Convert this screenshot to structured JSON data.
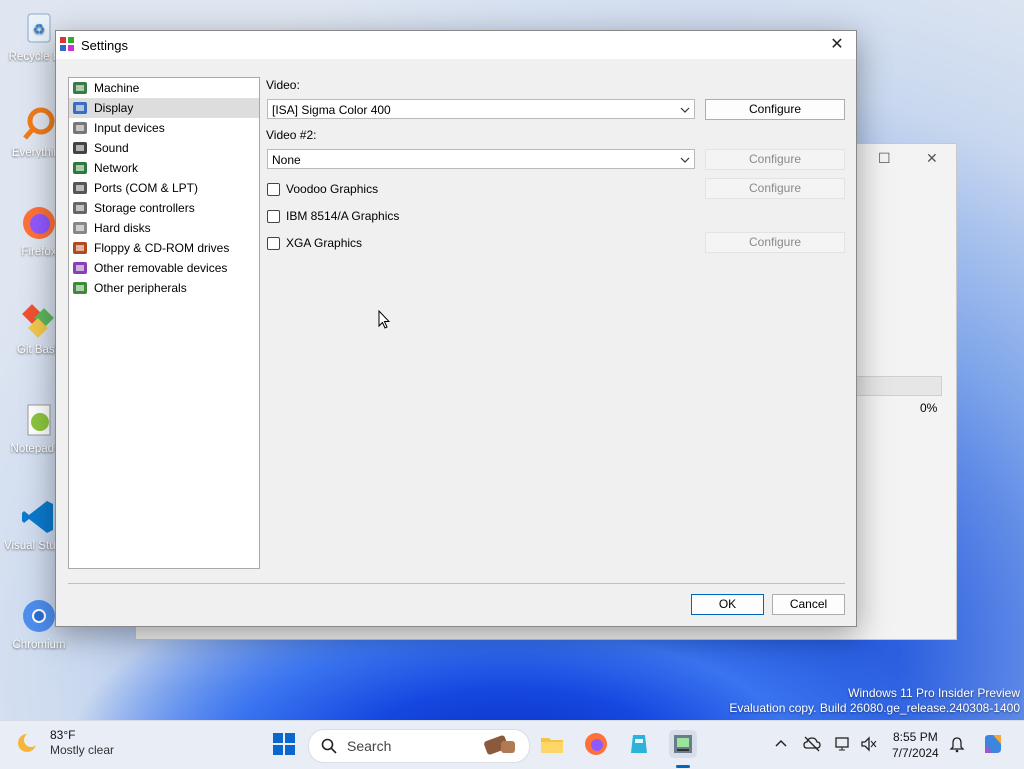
{
  "desktop": {
    "icons": [
      {
        "label": "Recycle Bin"
      },
      {
        "label": "Everything"
      },
      {
        "label": "Firefox"
      },
      {
        "label": "Git Bash"
      },
      {
        "label": "Notepad++"
      },
      {
        "label": "Visual Studio Code"
      },
      {
        "label": "Chromium"
      }
    ]
  },
  "background_window": {
    "progress_percent": 0,
    "progress_text": "0%"
  },
  "dialog": {
    "title": "Settings",
    "tree": [
      {
        "label": "Machine",
        "icon": "machine-icon",
        "selected": false
      },
      {
        "label": "Display",
        "icon": "display-icon",
        "selected": true
      },
      {
        "label": "Input devices",
        "icon": "input-devices-icon",
        "selected": false
      },
      {
        "label": "Sound",
        "icon": "sound-icon",
        "selected": false
      },
      {
        "label": "Network",
        "icon": "network-icon",
        "selected": false
      },
      {
        "label": "Ports (COM & LPT)",
        "icon": "ports-icon",
        "selected": false
      },
      {
        "label": "Storage controllers",
        "icon": "storage-controllers-icon",
        "selected": false
      },
      {
        "label": "Hard disks",
        "icon": "hard-disks-icon",
        "selected": false
      },
      {
        "label": "Floppy & CD-ROM drives",
        "icon": "floppy-cdrom-icon",
        "selected": false
      },
      {
        "label": "Other removable devices",
        "icon": "removable-devices-icon",
        "selected": false
      },
      {
        "label": "Other peripherals",
        "icon": "peripherals-icon",
        "selected": false
      }
    ],
    "video_label": "Video:",
    "video_value": "[ISA] Sigma Color 400",
    "video2_label": "Video #2:",
    "video2_value": "None",
    "configure_label": "Configure",
    "voodoo_label": "Voodoo Graphics",
    "ibm_label": "IBM 8514/A Graphics",
    "xga_label": "XGA Graphics",
    "ok_label": "OK",
    "cancel_label": "Cancel"
  },
  "watermark": {
    "line1": "Windows 11 Pro Insider Preview",
    "line2": "Evaluation copy. Build 26080.ge_release.240308-1400"
  },
  "taskbar": {
    "weather_temp": "83°F",
    "weather_desc": "Mostly clear",
    "search_placeholder": "Search",
    "time": "8:55 PM",
    "date": "7/7/2024"
  },
  "colors": {
    "accent": "#0067c0",
    "selection": "#dddddd"
  }
}
